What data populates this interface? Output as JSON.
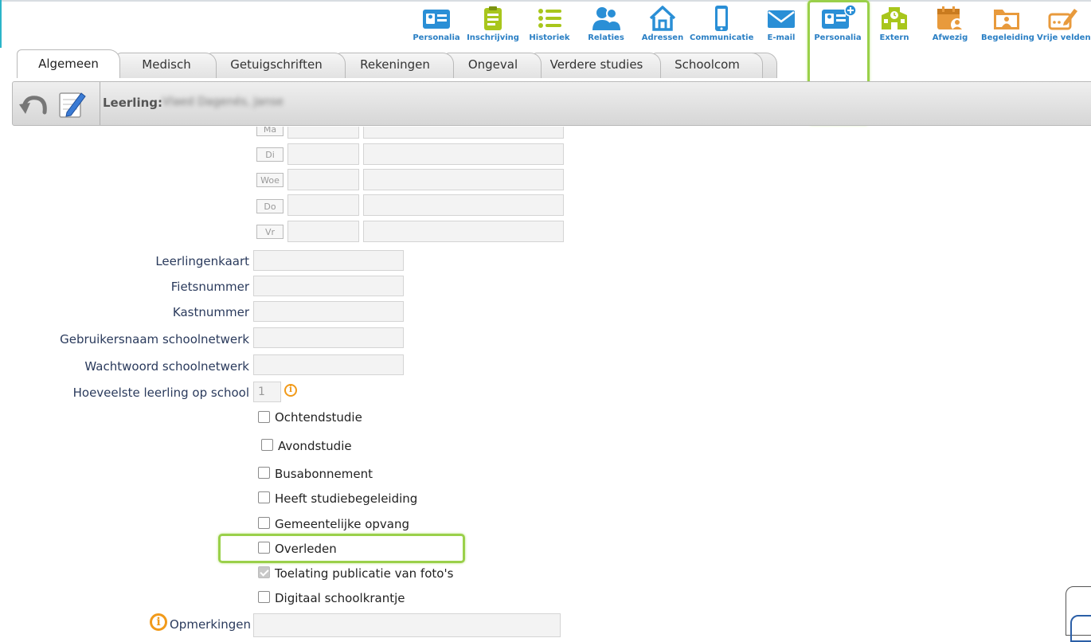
{
  "toolbar": {
    "items": [
      {
        "label": "Personalia",
        "icon": "id-card-icon",
        "color": "#2a8fd6"
      },
      {
        "label": "Inschrijving",
        "icon": "clipboard-icon",
        "color": "#a8c61c"
      },
      {
        "label": "Historiek",
        "icon": "list-icon",
        "color": "#a8c61c"
      },
      {
        "label": "Relaties",
        "icon": "users-icon",
        "color": "#2a8fd6"
      },
      {
        "label": "Adressen",
        "icon": "house-icon",
        "color": "#2a8fd6"
      },
      {
        "label": "Communicatie",
        "icon": "phone-icon",
        "color": "#2a8fd6"
      },
      {
        "label": "E-mail",
        "icon": "envelope-icon",
        "color": "#2a8fd6"
      },
      {
        "label": "Personalia",
        "icon": "id-card-plus-icon",
        "color": "#2a8fd6"
      },
      {
        "label": "Extern",
        "icon": "school-icon",
        "color": "#a8c61c"
      },
      {
        "label": "Afwezig",
        "icon": "calendar-user-icon",
        "color": "#e89a3c"
      },
      {
        "label": "Begeleiding",
        "icon": "folder-user-icon",
        "color": "#e89a3c"
      },
      {
        "label": "Vrije velden",
        "icon": "edit-icon",
        "color": "#e89a3c"
      }
    ]
  },
  "tabs": [
    "Algemeen",
    "Medisch",
    "Getuigschriften",
    "Rekeningen",
    "Ongeval",
    "Verdere studies",
    "Schoolcom"
  ],
  "active_tab": "Algemeen",
  "header": {
    "leerling_label": "Leerling:",
    "leerling_name": "Vlaed Dagenés, Janse"
  },
  "days": [
    "Ma",
    "Di",
    "Woe",
    "Do",
    "Vr"
  ],
  "fields": {
    "leerlingenkaart": {
      "label": "Leerlingenkaart",
      "value": ""
    },
    "fietsnummer": {
      "label": "Fietsnummer",
      "value": ""
    },
    "kastnummer": {
      "label": "Kastnummer",
      "value": ""
    },
    "gebruikersnaam": {
      "label": "Gebruikersnaam schoolnetwerk",
      "value": ""
    },
    "wachtwoord": {
      "label": "Wachtwoord schoolnetwerk",
      "value": ""
    },
    "hoeveelste": {
      "label": "Hoeveelste leerling op school",
      "value": "1"
    },
    "opmerkingen": {
      "label": "Opmerkingen",
      "value": ""
    }
  },
  "checkboxes": [
    {
      "label": "Ochtendstudie",
      "checked": false
    },
    {
      "label": "Avondstudie",
      "checked": false
    },
    {
      "label": "Busabonnement",
      "checked": false
    },
    {
      "label": "Heeft studiebegeleiding",
      "checked": false
    },
    {
      "label": "Gemeentelijke opvang",
      "checked": false
    },
    {
      "label": "Overleden",
      "checked": false
    },
    {
      "label": "Toelating publicatie van foto's",
      "checked": true
    },
    {
      "label": "Digitaal schoolkrantje",
      "checked": false
    }
  ],
  "colors": {
    "highlight": "#9ad04a",
    "label_text": "#2a3a5c",
    "info_icon": "#f19a1a"
  }
}
